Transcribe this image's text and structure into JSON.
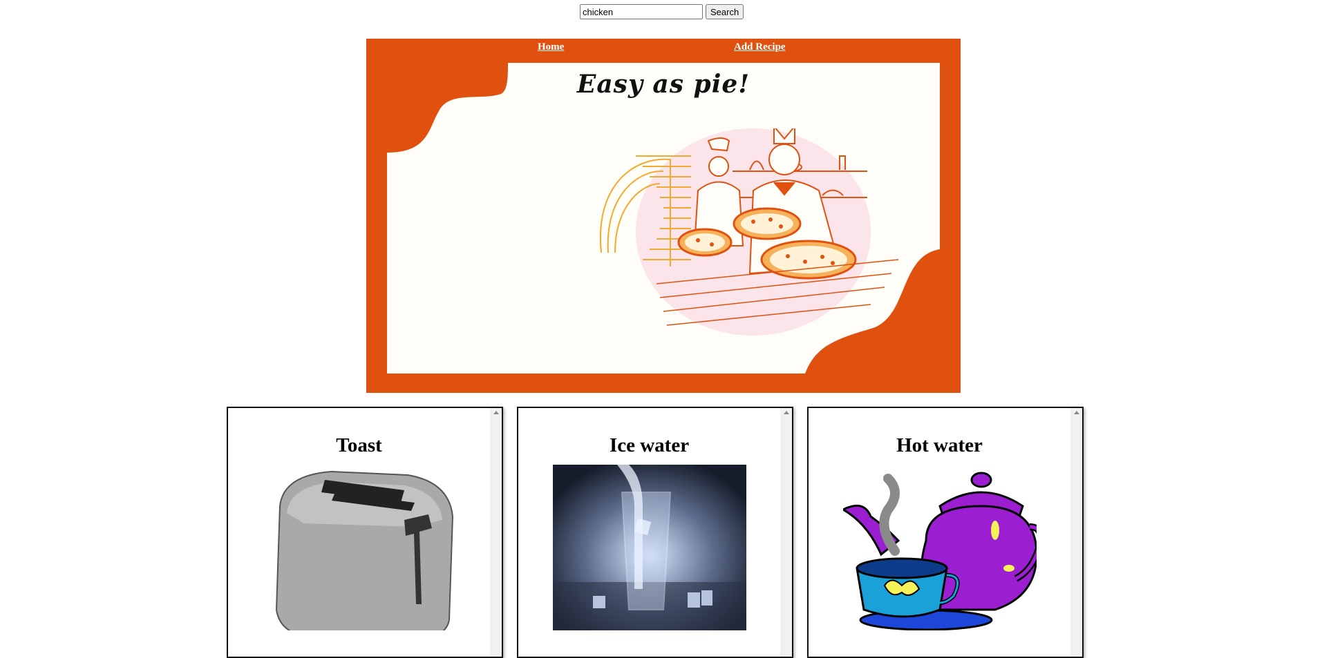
{
  "search": {
    "value": "chicken",
    "button_label": "Search"
  },
  "nav": {
    "home_label": "Home",
    "add_recipe_label": "Add Recipe"
  },
  "hero": {
    "title": "Easy as pie!"
  },
  "recipes": [
    {
      "title": "Toast",
      "image": "toaster-illustration"
    },
    {
      "title": "Ice water",
      "image": "glass-of-ice-water-photo"
    },
    {
      "title": "Hot water",
      "image": "teapot-and-cup-illustration"
    }
  ],
  "colors": {
    "accent": "#e0510f",
    "panel": "#fffdf8",
    "scrollbar": "#f1f1f1"
  }
}
